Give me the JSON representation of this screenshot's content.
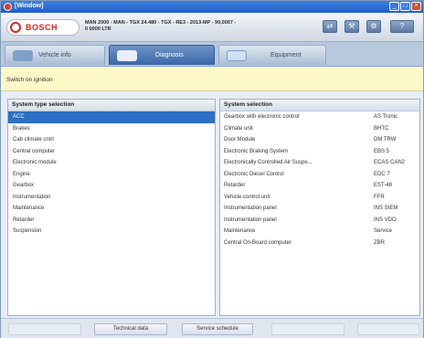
{
  "window": {
    "title": "[Window]"
  },
  "header": {
    "brand": "BOSCH",
    "vehicle_line1": "MAN 2000 - MAN - TGX 24.480 - TGX - RE3 - 2013-MP - 90,0007 -",
    "vehicle_line2": "0 0000 LTR"
  },
  "tabs": [
    {
      "label": "Vehicle info"
    },
    {
      "label": "Diagnosis"
    },
    {
      "label": "Equipment"
    }
  ],
  "status": {
    "text": "Switch on ignition"
  },
  "left_panel": {
    "header": "System type selection",
    "items": [
      "ACC",
      "Brakes",
      "Cab climate cntrl",
      "Central computer",
      "Electronic module",
      "Engine",
      "Gearbox",
      "Instrumentation",
      "Maintenance",
      "Retarder",
      "Suspension"
    ]
  },
  "right_panel": {
    "header": "System selection",
    "rows": [
      {
        "name": "Gearbox with electronic control",
        "code": "AS Tronic"
      },
      {
        "name": "Climate unit",
        "code": "BHTC"
      },
      {
        "name": "Door Module",
        "code": "DM TRW"
      },
      {
        "name": "Electronic Braking System",
        "code": "EBS 5"
      },
      {
        "name": "Electronically Controlled Air Suspe...",
        "code": "ECAS CAN2"
      },
      {
        "name": "Electronic Diesel Control",
        "code": "EDC 7"
      },
      {
        "name": "Retarder",
        "code": "EST-48"
      },
      {
        "name": "Vehicle control unit",
        "code": "FFR"
      },
      {
        "name": "Instrumentation panel",
        "code": "INS SIEM"
      },
      {
        "name": "Instrumentation panel",
        "code": "INS VDO"
      },
      {
        "name": "Maintenance",
        "code": "Service"
      },
      {
        "name": "Central On-Board computer",
        "code": "ZBR"
      }
    ]
  },
  "bottom": {
    "buttons": [
      "",
      "Technical data",
      "Service schedule",
      "",
      ""
    ]
  }
}
